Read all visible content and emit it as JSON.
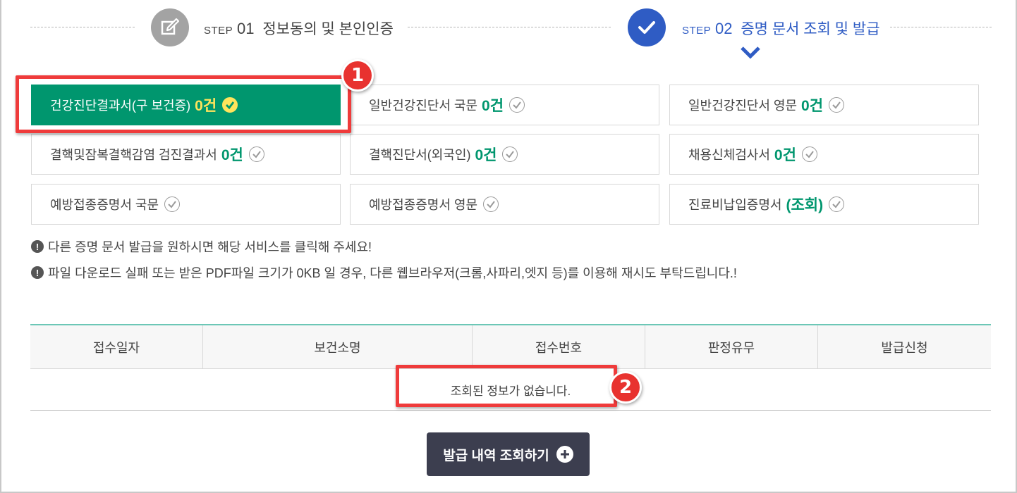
{
  "steps": [
    {
      "label": "STEP",
      "num": "01",
      "title": "정보동의 및 본인인증",
      "icon": "edit-icon"
    },
    {
      "label": "STEP",
      "num": "02",
      "title": "증명 문서 조회 및 발급",
      "icon": "check-icon"
    }
  ],
  "documents": [
    {
      "name": "건강진단결과서(구 보건증)",
      "count": "0건"
    },
    {
      "name": "일반건강진단서 국문",
      "count": "0건"
    },
    {
      "name": "일반건강진단서 영문",
      "count": "0건"
    },
    {
      "name": "결핵및잠복결핵감염 검진결과서",
      "count": "0건"
    },
    {
      "name": "결핵진단서(외국인)",
      "count": "0건"
    },
    {
      "name": "채용신체검사서",
      "count": "0건"
    },
    {
      "name": "예방접종증명서 국문",
      "count": ""
    },
    {
      "name": "예방접종증명서 영문",
      "count": ""
    },
    {
      "name": "진료비납입증명서",
      "count": "(조회)"
    }
  ],
  "notices": [
    "다른 증명 문서 발급을 원하시면 해당 서비스를 클릭해 주세요!",
    "파일 다운로드 실패 또는 받은 PDF파일 크기가 0KB 일 경우, 다른 웹브라우저(크롬,사파리,엣지 등)를 이용해 재시도 부탁드립니다.!"
  ],
  "table": {
    "headers": [
      "접수일자",
      "보건소명",
      "접수번호",
      "판정유무",
      "발급신청"
    ],
    "empty_message": "조회된 정보가 없습니다."
  },
  "button": {
    "label": "발급 내역 조회하기"
  },
  "badges": [
    "1",
    "2"
  ],
  "colors": {
    "accent_green": "#00966e",
    "step_blue": "#2f5cc4",
    "highlight_red": "#ef3b3b",
    "count_yellow": "#ffe45c",
    "button_dark": "#3c3e4f"
  }
}
